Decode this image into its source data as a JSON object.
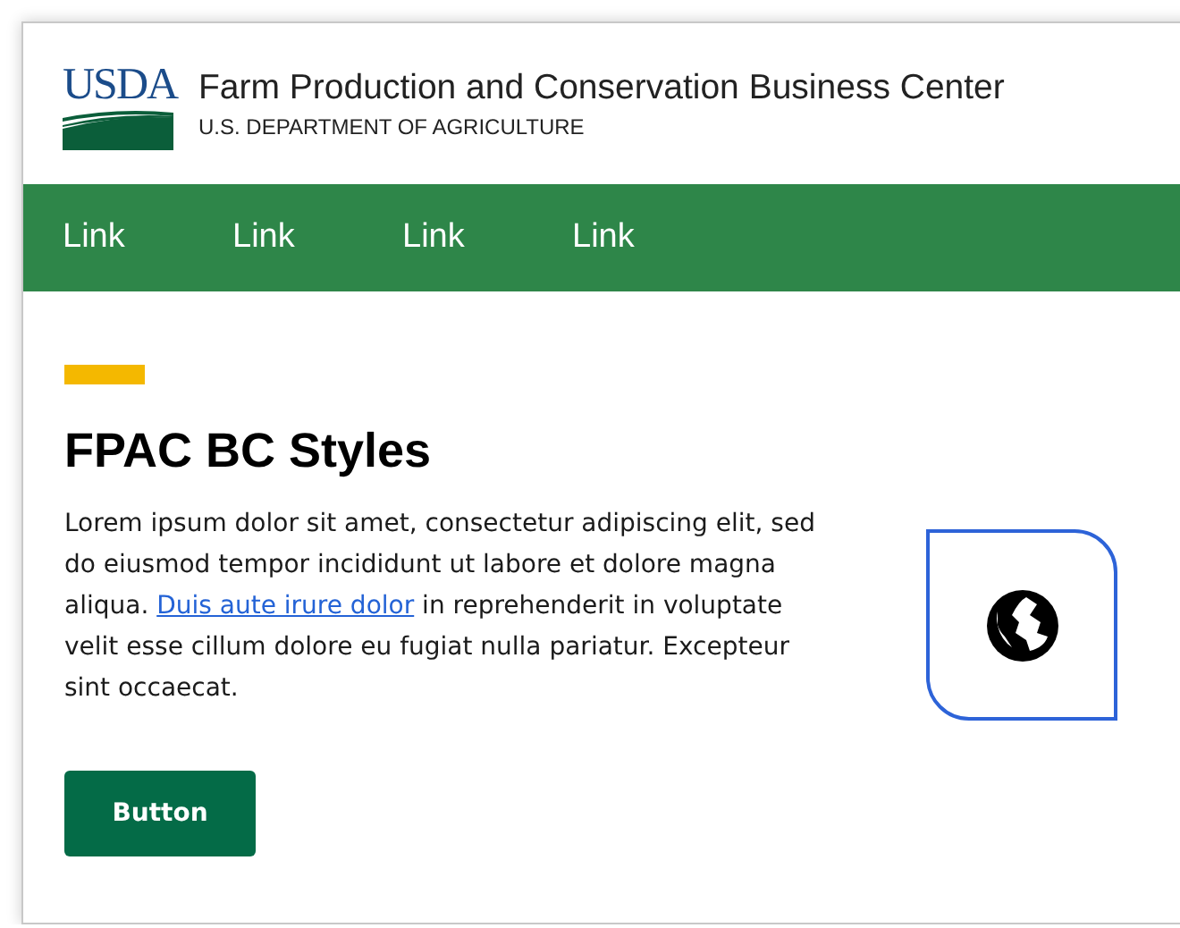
{
  "header": {
    "logo_text": "USDA",
    "title": "Farm Production and Conservation Business Center",
    "subtitle": "U.S. DEPARTMENT OF AGRICULTURE"
  },
  "nav": [
    {
      "label": "Link"
    },
    {
      "label": "Link"
    },
    {
      "label": "Link"
    },
    {
      "label": "Link"
    }
  ],
  "content": {
    "heading": "FPAC BC Styles",
    "paragraph": {
      "before": "Lorem ipsum dolor sit amet, consectetur adipiscing elit, sed do eiusmod tempor incididunt ut labore et dolore magna aliqua. ",
      "link": "Duis aute irure dolor",
      "after": " in reprehenderit in voluptate velit esse cillum dolore eu fugiat nulla pariatur. Excepteur sint occaecat."
    },
    "button": "Button"
  }
}
